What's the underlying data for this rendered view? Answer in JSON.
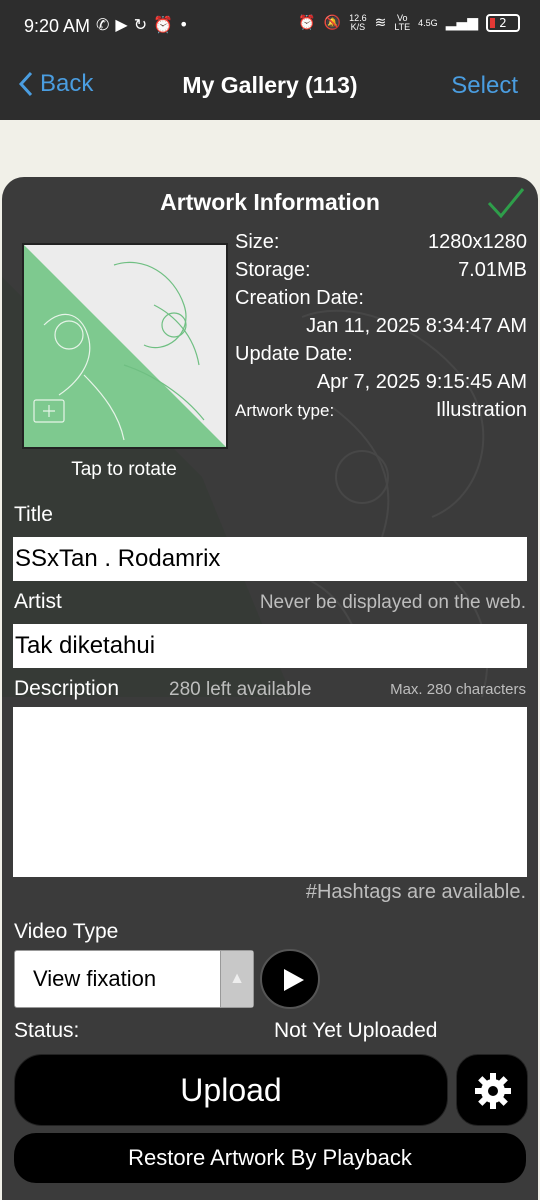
{
  "status_bar": {
    "time": "9:20 AM",
    "speed_value": "12.6",
    "speed_unit": "K/S",
    "volte_top": "Vo",
    "volte_bottom": "LTE",
    "network": "4.5G",
    "battery": "2"
  },
  "nav": {
    "back_label": "Back",
    "title": "My Gallery (113)",
    "select_label": "Select"
  },
  "panel": {
    "title": "Artwork Information",
    "rotate_label": "Tap to rotate",
    "size_label": "Size:",
    "size_value": "1280x1280",
    "storage_label": "Storage:",
    "storage_value": "7.01MB",
    "creation_label": "Creation Date:",
    "creation_value": "Jan 11, 2025 8:34:47 AM",
    "update_label": "Update Date:",
    "update_value": "Apr 7, 2025 9:15:45 AM",
    "type_label": "Artwork type:",
    "type_value": "Illustration"
  },
  "form": {
    "title_label": "Title",
    "title_value": "SSxTan . Rodamrix",
    "artist_label": "Artist",
    "artist_hint": "Never be displayed on the web.",
    "artist_value": "Tak diketahui",
    "description_label": "Description",
    "description_remaining": "280 left available",
    "description_max": "Max. 280 characters",
    "description_value": "",
    "hashtags_hint": "#Hashtags are available.",
    "video_type_label": "Video Type",
    "video_type_value": "View fixation",
    "status_label": "Status:",
    "status_value": "Not Yet Uploaded"
  },
  "actions": {
    "upload_label": "Upload",
    "restore_label": "Restore Artwork By Playback"
  },
  "colors": {
    "accent_blue": "#4a9de0",
    "check_green": "#2e9e4a",
    "thumb_green": "#7ec98f"
  }
}
